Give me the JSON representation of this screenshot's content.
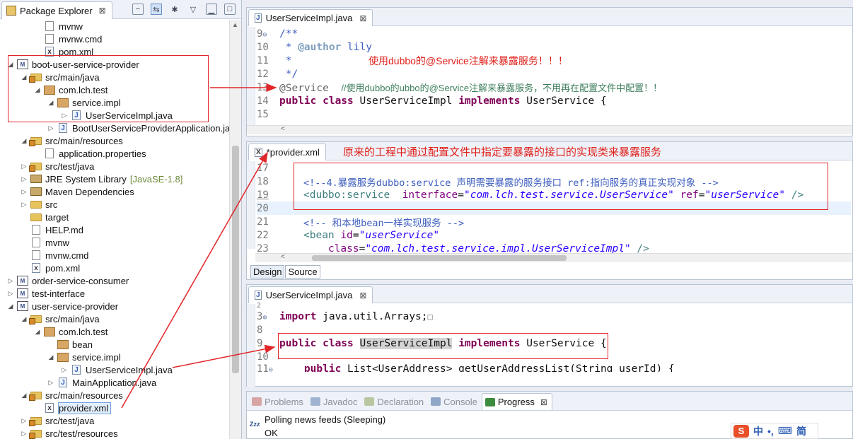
{
  "package_explorer": {
    "title": "Package Explorer",
    "close": "⊠",
    "tree": [
      {
        "label": "mvnw",
        "icon": "file",
        "indent": 2
      },
      {
        "label": "mvnw.cmd",
        "icon": "file",
        "indent": 2
      },
      {
        "label": "pom.xml",
        "icon": "xml",
        "indent": 2
      },
      {
        "label": "boot-user-service-provider",
        "icon": "maven-project",
        "indent": 0,
        "twisty": "expanded"
      },
      {
        "label": "src/main/java",
        "icon": "src-folder",
        "indent": 1,
        "twisty": "expanded"
      },
      {
        "label": "com.lch.test",
        "icon": "package",
        "indent": 2,
        "twisty": "expanded"
      },
      {
        "label": "service.impl",
        "icon": "package",
        "indent": 3,
        "twisty": "expanded"
      },
      {
        "label": "UserServiceImpl.java",
        "icon": "java",
        "indent": 4,
        "twisty": "collapsed"
      },
      {
        "label": "BootUserServiceProviderApplication.ja",
        "icon": "java",
        "indent": 3,
        "twisty": "collapsed"
      },
      {
        "label": "src/main/resources",
        "icon": "src-folder",
        "indent": 1,
        "twisty": "expanded"
      },
      {
        "label": "application.properties",
        "icon": "props",
        "indent": 2
      },
      {
        "label": "src/test/java",
        "icon": "src-folder",
        "indent": 1,
        "twisty": "collapsed"
      },
      {
        "label": "JRE System Library",
        "icon": "library",
        "indent": 1,
        "twisty": "collapsed",
        "decoration": "[JavaSE-1.8]"
      },
      {
        "label": "Maven Dependencies",
        "icon": "library",
        "indent": 1,
        "twisty": "collapsed"
      },
      {
        "label": "src",
        "icon": "folder",
        "indent": 1,
        "twisty": "collapsed"
      },
      {
        "label": "target",
        "icon": "folder",
        "indent": 1
      },
      {
        "label": "HELP.md",
        "icon": "file",
        "indent": 1
      },
      {
        "label": "mvnw",
        "icon": "file",
        "indent": 1
      },
      {
        "label": "mvnw.cmd",
        "icon": "file",
        "indent": 1
      },
      {
        "label": "pom.xml",
        "icon": "xml",
        "indent": 1
      },
      {
        "label": "order-service-consumer",
        "icon": "maven-project",
        "indent": 0,
        "twisty": "collapsed"
      },
      {
        "label": "test-interface",
        "icon": "maven-project",
        "indent": 0,
        "twisty": "collapsed"
      },
      {
        "label": "user-service-provider",
        "icon": "maven-project",
        "indent": 0,
        "twisty": "expanded"
      },
      {
        "label": "src/main/java",
        "icon": "src-folder",
        "indent": 1,
        "twisty": "expanded"
      },
      {
        "label": "com.lch.test",
        "icon": "package",
        "indent": 2,
        "twisty": "expanded"
      },
      {
        "label": "bean",
        "icon": "package",
        "indent": 3
      },
      {
        "label": "service.impl",
        "icon": "package",
        "indent": 3,
        "twisty": "expanded"
      },
      {
        "label": "UserServiceImpl.java",
        "icon": "java",
        "indent": 4,
        "twisty": "collapsed"
      },
      {
        "label": "MainApplication.java",
        "icon": "java",
        "indent": 3,
        "twisty": "collapsed"
      },
      {
        "label": "src/main/resources",
        "icon": "src-folder",
        "indent": 1,
        "twisty": "expanded"
      },
      {
        "label": "provider.xml",
        "icon": "xml",
        "indent": 2,
        "selected": true
      },
      {
        "label": "src/test/java",
        "icon": "src-folder",
        "indent": 1,
        "twisty": "collapsed"
      },
      {
        "label": "src/test/resources",
        "icon": "src-folder",
        "indent": 1,
        "twisty": "collapsed"
      }
    ]
  },
  "editor1": {
    "tab": "UserServiceImpl.java",
    "lines": [
      {
        "n": "9",
        "text": "/**",
        "style": "cmt",
        "fold": "⊖"
      },
      {
        "n": "10",
        "text": " * @author lily",
        "style": "cmt-author"
      },
      {
        "n": "11",
        "text": " *",
        "style": "cmt",
        "note": "使用dubbo的@Service注解来暴露服务！！！"
      },
      {
        "n": "12",
        "text": " */",
        "style": "cmt"
      },
      {
        "n": "13",
        "text": "@Service  //使用dubbo的ubbo的@Service注解来暴露服务，不用再在配置文件中配置！！",
        "style": "ann-line"
      },
      {
        "n": "14",
        "text": "public class UserServiceImpl implements UserService {",
        "style": "class-line"
      },
      {
        "n": "15",
        "text": "",
        "style": "plain"
      }
    ]
  },
  "editor2": {
    "tab": "*provider.xml",
    "title_note": "原来的工程中通过配置文件中指定要暴露的接口的实现类来暴露服务",
    "lines": [
      {
        "n": "17",
        "text": ""
      },
      {
        "n": "18",
        "text": "<!--4.暴露服务dubbo:service 声明需要暴露的服务接口 ref:指向服务的真正实现对象 -->"
      },
      {
        "n": "19",
        "text": "<dubbo:service  interface=\"com.lch.test.service.UserService\" ref=\"userService\" />"
      },
      {
        "n": "20",
        "text": ""
      },
      {
        "n": "21",
        "text": "<!-- 和本地bean一样实现服务 -->"
      },
      {
        "n": "22",
        "text": "<bean id=\"userService\""
      },
      {
        "n": "23",
        "text": "    class=\"com.lch.test.service.impl.UserServiceImpl\" />"
      }
    ],
    "sub_tabs": [
      "Design",
      "Source"
    ]
  },
  "editor3": {
    "tab": "UserServiceImpl.java",
    "lines": [
      {
        "n": "2",
        "text": ""
      },
      {
        "n": "3",
        "text": "import java.util.Arrays;",
        "fold": "⊕"
      },
      {
        "n": "8",
        "text": ""
      },
      {
        "n": "9",
        "text": "public class UserServiceImpl implements UserService {"
      },
      {
        "n": "10",
        "text": ""
      },
      {
        "n": "11",
        "text": "    public List<UserAddress> getUserAddressList(String userId) {",
        "fold": "⊖"
      }
    ]
  },
  "console": {
    "tabs": [
      {
        "label": "Problems",
        "icon": "problems-icon"
      },
      {
        "label": "Javadoc",
        "icon": "javadoc-icon"
      },
      {
        "label": "Declaration",
        "icon": "declaration-icon"
      },
      {
        "label": "Console",
        "icon": "console-icon"
      },
      {
        "label": "Progress",
        "icon": "progress-icon",
        "active": true
      }
    ],
    "progress_badge": "Zzz",
    "line1": "Polling news feeds (Sleeping)",
    "line2": "OK"
  },
  "ime": {
    "logo": "S",
    "lang": "中",
    "punct": "•,",
    "keyboard": "⌨",
    "mode": "简"
  },
  "colors": {
    "annotation_red": "#e1262a",
    "keyword": "#7f0055",
    "comment": "#3f5fbf",
    "string": "#2a00ff"
  }
}
